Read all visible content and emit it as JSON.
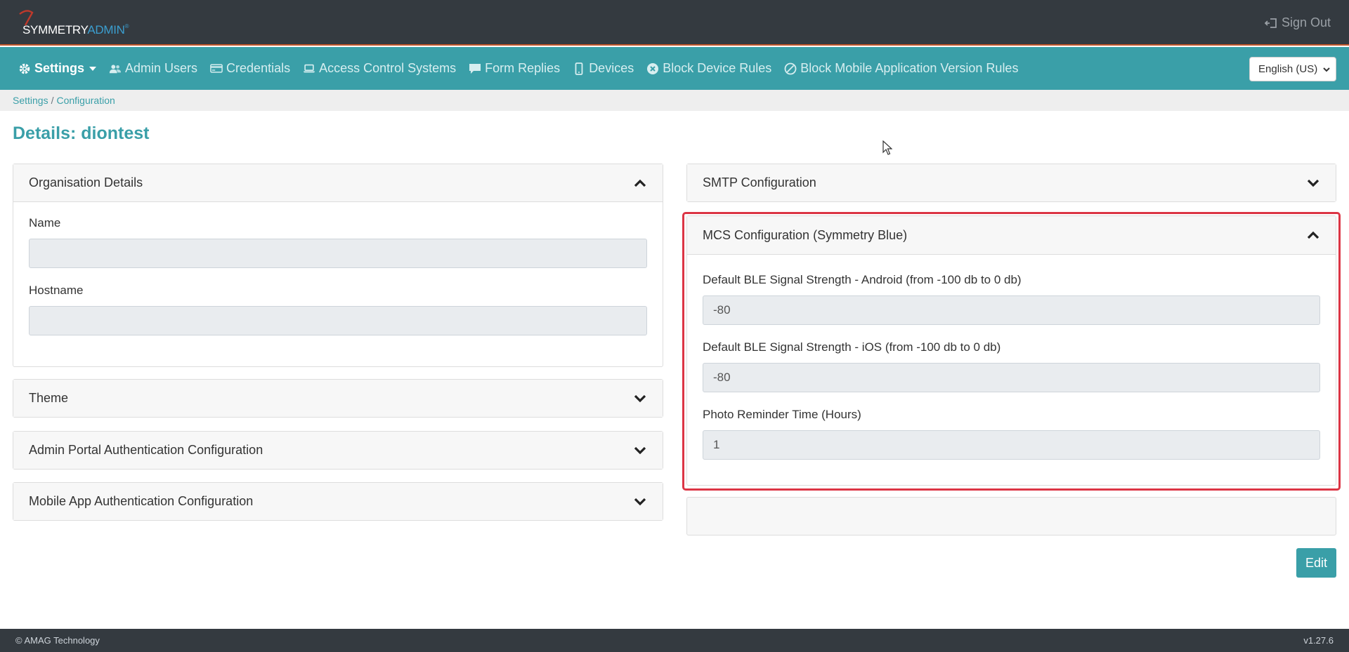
{
  "header": {
    "logo_symmetry": "SYMMETRY",
    "logo_admin": "ADMIN",
    "logo_tm": "®",
    "signout_label": "Sign Out"
  },
  "nav": {
    "items": [
      {
        "label": "Settings",
        "icon": "gear-icon",
        "active": true
      },
      {
        "label": "Admin Users",
        "icon": "users-icon"
      },
      {
        "label": "Credentials",
        "icon": "credit-card-icon"
      },
      {
        "label": "Access Control Systems",
        "icon": "laptop-icon"
      },
      {
        "label": "Form Replies",
        "icon": "comment-icon"
      },
      {
        "label": "Devices",
        "icon": "mobile-icon"
      },
      {
        "label": "Block Device Rules",
        "icon": "times-circle-icon"
      },
      {
        "label": "Block Mobile Application Version Rules",
        "icon": "ban-icon"
      }
    ],
    "language": "English (US)"
  },
  "breadcrumb": {
    "settings": "Settings",
    "separator": "/",
    "configuration": "Configuration"
  },
  "page_title": "Details: diontest",
  "left_panels": {
    "org": {
      "title": "Organisation Details",
      "name_label": "Name",
      "name_value": "",
      "hostname_label": "Hostname",
      "hostname_value": ""
    },
    "theme": {
      "title": "Theme"
    },
    "admin_auth": {
      "title": "Admin Portal Authentication Configuration"
    },
    "mobile_auth": {
      "title": "Mobile App Authentication Configuration"
    }
  },
  "right_panels": {
    "smtp": {
      "title": "SMTP Configuration"
    },
    "mcs": {
      "title": "MCS Configuration (Symmetry Blue)",
      "android_label": "Default BLE Signal Strength - Android (from -100 db to 0 db)",
      "android_value": "-80",
      "ios_label": "Default BLE Signal Strength - iOS (from -100 db to 0 db)",
      "ios_value": "-80",
      "photo_label": "Photo Reminder Time (Hours)",
      "photo_value": "1"
    }
  },
  "edit_label": "Edit",
  "footer": {
    "copyright": "© AMAG Technology",
    "version": "v1.27.6"
  },
  "colors": {
    "teal": "#3a9fa8",
    "header_dark": "#343a40",
    "highlight_red": "#dc3545"
  }
}
